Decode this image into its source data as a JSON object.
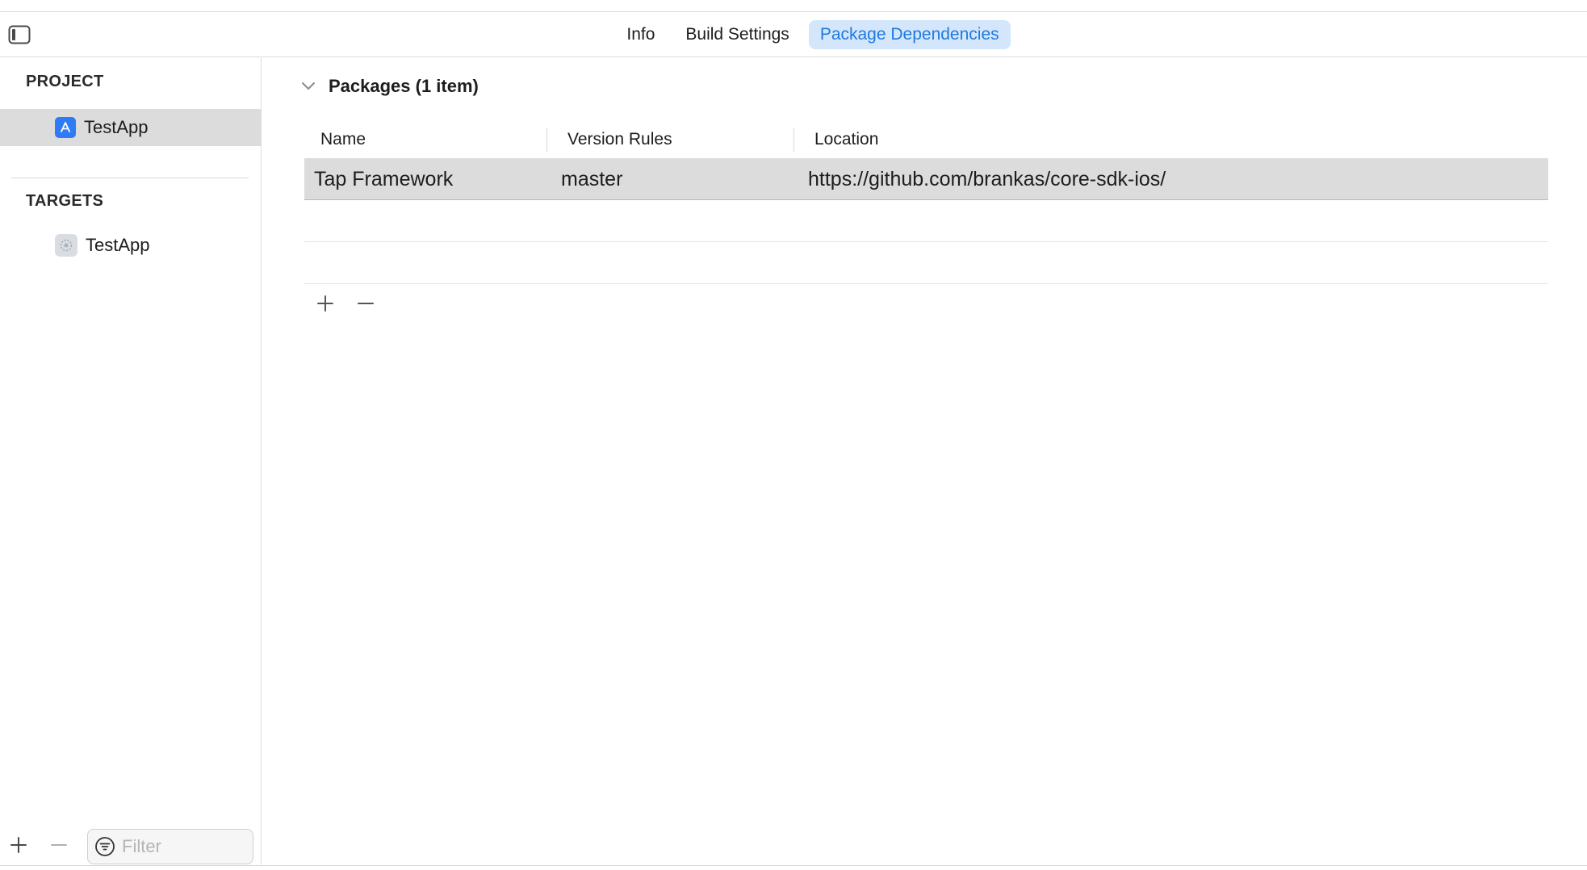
{
  "tabs": [
    {
      "label": "Info"
    },
    {
      "label": "Build Settings"
    },
    {
      "label": "Package Dependencies",
      "active": true
    }
  ],
  "sidebar": {
    "project_heading": "PROJECT",
    "project_items": [
      {
        "label": "TestApp",
        "icon": "app-store-icon"
      }
    ],
    "targets_heading": "TARGETS",
    "target_items": [
      {
        "label": "TestApp",
        "icon": "target-app-icon"
      }
    ],
    "filter_placeholder": "Filter"
  },
  "packages": {
    "section_title": "Packages (1 item)",
    "columns": [
      "Name",
      "Version Rules",
      "Location"
    ],
    "rows": [
      {
        "name": "Tap Framework",
        "version_rule": "master",
        "location": "https://github.com/brankas/core-sdk-ios/"
      }
    ]
  },
  "colors": {
    "accent": "#1f7ae0",
    "tab_active_bg": "#d3e6fb",
    "selection_bg": "#dcdcdc"
  }
}
